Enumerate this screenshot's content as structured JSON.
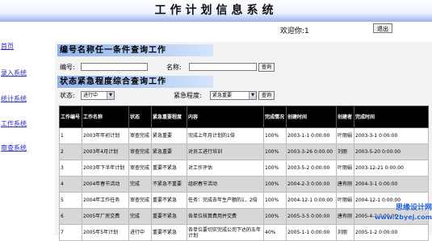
{
  "header": {
    "title": "工作计划信息系统"
  },
  "user": {
    "welcome": "欢迎你:1",
    "logout_label": "退出"
  },
  "sidebar": {
    "items": [
      {
        "label": "首页"
      },
      {
        "label": "录入系统"
      },
      {
        "label": "统计系统"
      },
      {
        "label": "工作系统"
      },
      {
        "label": "审查系统"
      }
    ]
  },
  "query1": {
    "title": "编号名称任一条件查询工作",
    "id_label": "编号:",
    "id_value": "",
    "name_label": "名称:",
    "name_value": "",
    "button": "查询"
  },
  "query2": {
    "title": "状态紧急程度综合查询工作",
    "status_label": "状态:",
    "status_value": "进行中",
    "urgency_label": "紧急程度:",
    "urgency_value": "紧急重要",
    "button": "查询"
  },
  "table": {
    "headers": [
      "工作编号",
      "工作名称",
      "状态",
      "紧急重要程度",
      "内容",
      "完成情况",
      "创建时间",
      "创建者",
      "完成时间"
    ],
    "rows": [
      [
        "1",
        "2003年年初计划",
        "审查完成",
        "紧急重要",
        "完成上年月计划的1倍",
        "100%",
        "2003-1-1 0:00:00",
        "叶丽娟",
        "2003-3-1 0:00:00"
      ],
      [
        "2",
        "2003年4月计划",
        "审查完成",
        "紧急重要",
        "对员工进行培训",
        "100%",
        "2003-3-26 0:00:00",
        "刘丽",
        "2003-5-20 0:00:00"
      ],
      [
        "3",
        "2003年下半年计划",
        "审查完成",
        "重要不紧急",
        "对工作评估",
        "100%",
        "2003-5-2 0:00:00",
        "叶丽娟",
        "2003-12-21 0:00:00"
      ],
      [
        "4",
        "2004年春节活动",
        "完成",
        "不紧急不重要",
        "组织春节活动",
        "100%",
        "2004-2-3 0:00:00",
        "唐有刚",
        "2004-3-1 0:00:00"
      ],
      [
        "5",
        "2004年工作任务",
        "审查完成",
        "重要不紧急",
        "任务：完成去年生产额的1．2倍",
        "100%",
        "2004-12-1 0:00:00",
        "叶丽娟",
        "2004-12-1 0:00:00"
      ],
      [
        "6",
        "2005年厂房交费",
        "完成",
        "重要不紧急",
        "各单位核算费用并交费",
        "100%",
        "2005-3-5 0:00:00",
        "唐有刚",
        "2005-4-2 0:00:00"
      ],
      [
        "7",
        "2005年5年计划",
        "进行中",
        "重要不紧急",
        "各单位要切实完成公司下达的五年计划",
        "40%",
        "2005-1-1 0:00:00",
        "刘丽",
        "2005-1-2 0:00:00"
      ]
    ]
  },
  "watermark": {
    "line1": "思缘设计网",
    "line2": "www.2byej.com"
  }
}
